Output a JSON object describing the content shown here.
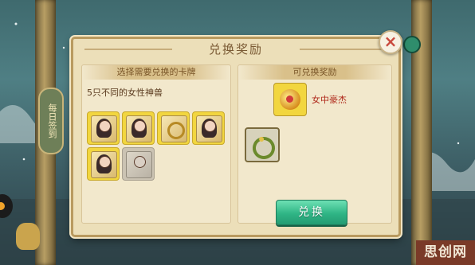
{
  "dialog": {
    "title": "兑换奖励",
    "left_header": "选择需要兑换的卡牌",
    "subtitle": "5只不同的女性神兽",
    "right_header": "可兑换奖励",
    "exchange_label": "兑换",
    "close_glyph": "×"
  },
  "cards": [
    {
      "icon": "female-beast-card-1",
      "state": "selected"
    },
    {
      "icon": "female-beast-card-2",
      "state": "selected"
    },
    {
      "icon": "female-beast-card-3",
      "state": "selected"
    },
    {
      "icon": "female-beast-card-4",
      "state": "selected"
    },
    {
      "icon": "female-beast-card-5",
      "state": "selected"
    },
    {
      "icon": "female-beast-card-6",
      "state": "greyed"
    }
  ],
  "rewards": [
    {
      "label": "女中豪杰",
      "icon": "gem-treasure-icon"
    },
    {
      "label": "",
      "icon": "jade-ring-icon"
    }
  ],
  "background": {
    "side_tab_label": "每日签到"
  },
  "watermark": "思创网",
  "colors": {
    "dialog_bg": "#ecdfb9",
    "card_selected": "#f2d63f",
    "exchange_button": "#2fb585",
    "reward_label": "#b02a1c"
  }
}
